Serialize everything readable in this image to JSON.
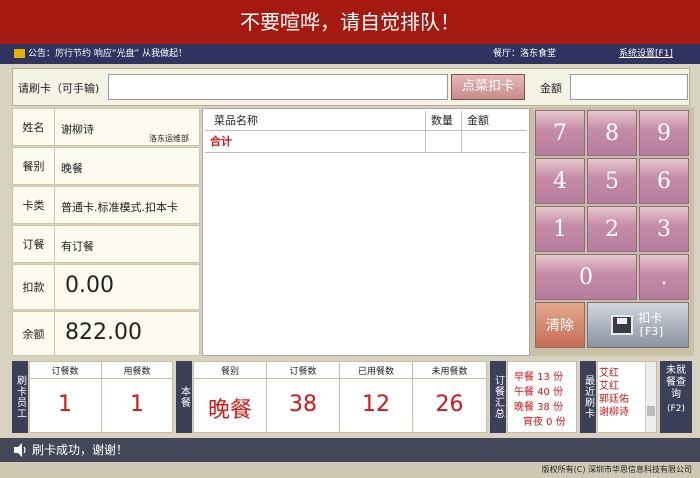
{
  "banner": {
    "text": "不要喧哗，请自觉排队！"
  },
  "notice": {
    "text": "公告：厉行节约 响应“光盘”  从我做起！",
    "restaurant": "餐厅：洛东食堂",
    "settings": "系统设置[F1]"
  },
  "card": {
    "label": "请刷卡（可手输)",
    "value": "",
    "button": "点菜扣卡",
    "amount_label": "金额",
    "amount_value": ""
  },
  "info": {
    "name_label": "姓名",
    "name": "谢柳诗",
    "dept": "洛东运维部",
    "meal_label": "餐别",
    "meal": "晚餐",
    "cardtype_label": "卡类",
    "cardtype": "普通卡.标准模式.扣本卡",
    "order_label": "订餐",
    "order": "有订餐",
    "deduct_label": "扣款",
    "deduct": "0.00",
    "balance_label": "余额",
    "balance": "822.00"
  },
  "table": {
    "col_name": "菜品名称",
    "col_qty": "数量",
    "col_amount": "金额",
    "total_label": "合计"
  },
  "keypad": {
    "k7": "7",
    "k8": "8",
    "k9": "9",
    "k4": "4",
    "k5": "5",
    "k6": "6",
    "k1": "1",
    "k2": "2",
    "k3": "3",
    "k0": "0",
    "kdot": ".",
    "clear": "清除",
    "card": "扣卡",
    "card_key": "[F3]"
  },
  "staff": {
    "tag": "刷卡员工",
    "order_head": "订餐数",
    "used_head": "用餐数",
    "order": "1",
    "used": "1"
  },
  "thismeal": {
    "tag": "本餐",
    "meal_head": "餐别",
    "order_head": "订餐数",
    "used_head": "已用餐数",
    "unused_head": "未用餐数",
    "meal": "晚餐",
    "order": "38",
    "used": "12",
    "unused": "26"
  },
  "summary": {
    "tag": "订餐汇总",
    "lines": [
      "早餐 13 份",
      "午餐 40 份",
      "晚餐 38 份",
      "宵夜 0 份"
    ]
  },
  "recent": {
    "tag": "最近刷卡",
    "names": [
      "艾红",
      "艾红",
      "郭廷佑",
      "谢柳诗"
    ]
  },
  "unmeal": {
    "label": "未就餐查询",
    "key": "(F2)"
  },
  "status": {
    "text": "刷卡成功，谢谢！"
  },
  "copyright": {
    "text": "版权所有(C) 深圳市华思信息科技有限公司"
  }
}
